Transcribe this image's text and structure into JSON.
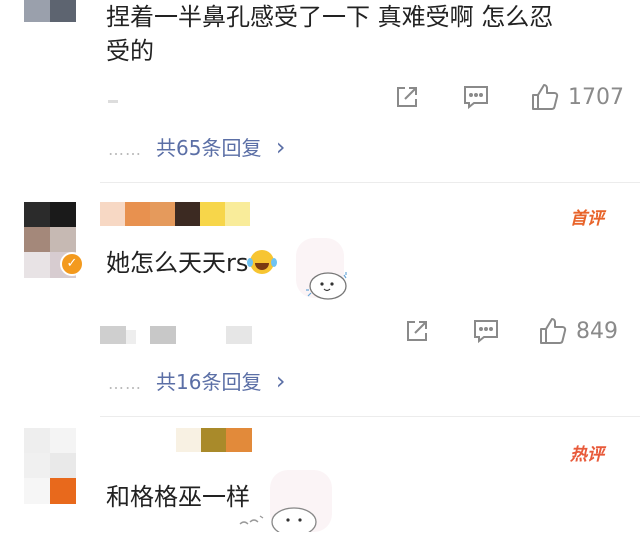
{
  "comments": [
    {
      "text_line1": "捏着一半鼻孔感受了一下 真难受啊 怎么忍",
      "text_line2": "受的",
      "like_count": "1707",
      "reply_label": "共65条回复",
      "reply_dots": "……",
      "reply_chevron": "›"
    },
    {
      "text": "她怎么天天rs",
      "badge": "首评",
      "like_count": "849",
      "reply_label": "共16条回复",
      "reply_dots": "……",
      "reply_chevron": "›"
    },
    {
      "text": "和格格巫一样",
      "badge": "热评"
    }
  ]
}
